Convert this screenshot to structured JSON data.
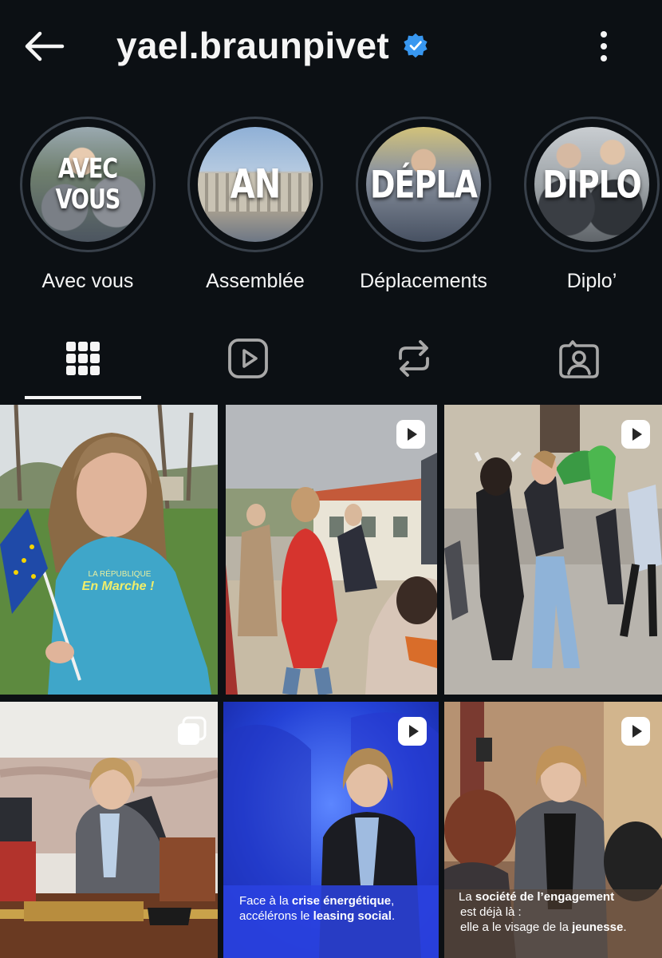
{
  "header": {
    "username": "yael.braunpivet",
    "back_icon": "arrow-left-icon",
    "verified_icon": "verified-badge-icon",
    "verified_color": "#3897f0",
    "more_icon": "more-vertical-icon"
  },
  "highlights": [
    {
      "cover_text": "AVEC VOUS",
      "label": "Avec vous"
    },
    {
      "cover_text": "AN",
      "label": "Assemblée"
    },
    {
      "cover_text": "DÉPLA",
      "label": "Déplacements"
    },
    {
      "cover_text": "DIPLO",
      "label": "Diplo’"
    }
  ],
  "tabs": [
    {
      "icon": "grid-icon",
      "active": true
    },
    {
      "icon": "reels-icon",
      "active": false
    },
    {
      "icon": "reposts-icon",
      "active": false
    },
    {
      "icon": "tagged-icon",
      "active": false
    }
  ],
  "posts": [
    {
      "type": "photo",
      "shirt_line1": "LA RÉPUBLIQUE",
      "shirt_line2": "En Marche !"
    },
    {
      "type": "reel"
    },
    {
      "type": "reel"
    },
    {
      "type": "carousel"
    },
    {
      "type": "reel",
      "caption_line1_pre": "Face à la ",
      "caption_line1_bold": "crise énergétique",
      "caption_line1_post": ",",
      "caption_line2_pre": "accélérons le ",
      "caption_line2_bold": "leasing social",
      "caption_line2_post": "."
    },
    {
      "type": "reel",
      "caption_line1_pre": "La ",
      "caption_line1_bold": "société de l’engagement",
      "caption_line2_pre": "est déjà là :",
      "caption_line3_pre": "elle a le visage de la ",
      "caption_line3_bold": "jeunesse",
      "caption_line3_post": "."
    }
  ]
}
